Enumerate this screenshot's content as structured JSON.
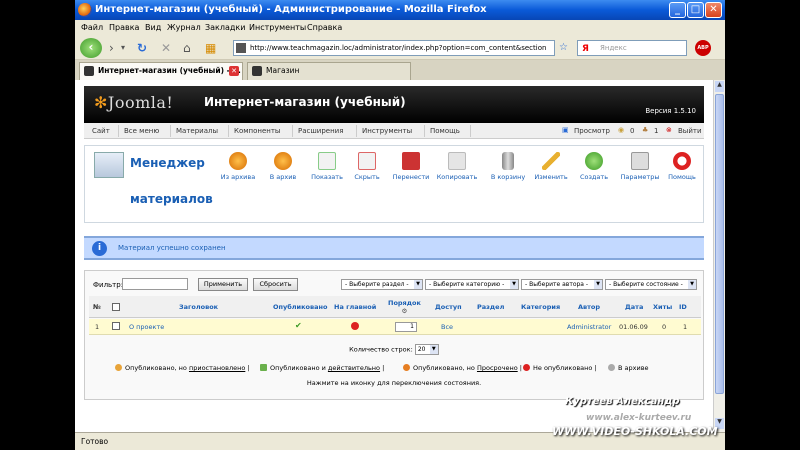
{
  "window": {
    "title": "Интернет-магазин (учебный) - Администрирование - Mozilla Firefox"
  },
  "menubar": [
    "Файл",
    "Правка",
    "Вид",
    "Журнал",
    "Закладки",
    "Инструменты",
    "Справка"
  ],
  "navbar": {
    "url": "http://www.teachmagazin.loc/administrator/index.php?option=com_content&section",
    "search_engine": "Я",
    "search_placeholder": "Яндекс"
  },
  "tabs": [
    {
      "label": "Интернет-магазин (учебный) - ...",
      "active": true
    },
    {
      "label": "Магазин",
      "active": false
    }
  ],
  "joomla": {
    "logo": "Joomla!",
    "site_title": "Интернет-магазин (учебный)",
    "version": "Версия 1.5.10",
    "menu": [
      "Сайт",
      "Все меню",
      "Материалы",
      "Компоненты",
      "Расширения",
      "Инструменты",
      "Помощь"
    ],
    "menu_right": {
      "preview": "Просмотр",
      "messages": "0",
      "users": "1",
      "logout": "Выйти"
    },
    "page_title_line1": "Менеджер",
    "page_title_line2": "материалов",
    "toolbar": [
      {
        "label": "Из архива",
        "icon": "unarchive-icon"
      },
      {
        "label": "В архив",
        "icon": "archive-icon"
      },
      {
        "label": "Показать",
        "icon": "publish-icon"
      },
      {
        "label": "Скрыть",
        "icon": "unpublish-icon"
      },
      {
        "label": "Перенести",
        "icon": "move-icon"
      },
      {
        "label": "Копировать",
        "icon": "copy-icon"
      },
      {
        "label": "В корзину",
        "icon": "trash-icon"
      },
      {
        "label": "Изменить",
        "icon": "edit-icon"
      },
      {
        "label": "Создать",
        "icon": "new-icon"
      },
      {
        "label": "Параметры",
        "icon": "parameters-icon"
      },
      {
        "label": "Помощь",
        "icon": "help-icon"
      }
    ],
    "message": "Материал успешно сохранен",
    "filter": {
      "label": "Фильтр:",
      "value": "",
      "apply": "Применить",
      "reset": "Сбросить",
      "selects": [
        "- Выберите раздел -",
        "- Выберите категорию -",
        "- Выберите автора -",
        "- Выберите состояние -"
      ]
    },
    "columns": [
      "№",
      "Заголовок",
      "Опубликовано",
      "На главной",
      "Порядок",
      "Доступ",
      "Раздел",
      "Категория",
      "Автор",
      "Дата",
      "Хиты",
      "ID"
    ],
    "rows": [
      {
        "num": "1",
        "title": "О проекте",
        "order": "1",
        "access": "Все",
        "section": "",
        "category": "",
        "author": "Administrator",
        "date": "01.06.09",
        "hits": "0",
        "id": "1"
      }
    ],
    "pager_label": "Количество строк:",
    "pager_value": "20",
    "legend": [
      {
        "text_pre": "Опубликовано, но ",
        "text_link": "приостановлено",
        "text_post": " |"
      },
      {
        "text_pre": "Опубликовано и ",
        "text_link": "действительно",
        "text_post": " |"
      },
      {
        "text_pre": "Опубликовано, но ",
        "text_link": "Просрочено",
        "text_post": " |"
      },
      {
        "text_pre": "Не опубликовано",
        "text_link": "",
        "text_post": " |"
      },
      {
        "text_pre": "В архиве",
        "text_link": "",
        "text_post": ""
      }
    ],
    "hint": "Нажмите на иконку для переключения состояния."
  },
  "statusbar": "Готово",
  "watermark": {
    "author": "Куртеев Александр",
    "site1": "www.alex-kurteev.ru",
    "site2": "WWW.VIDEO-SHKOLA.COM"
  }
}
